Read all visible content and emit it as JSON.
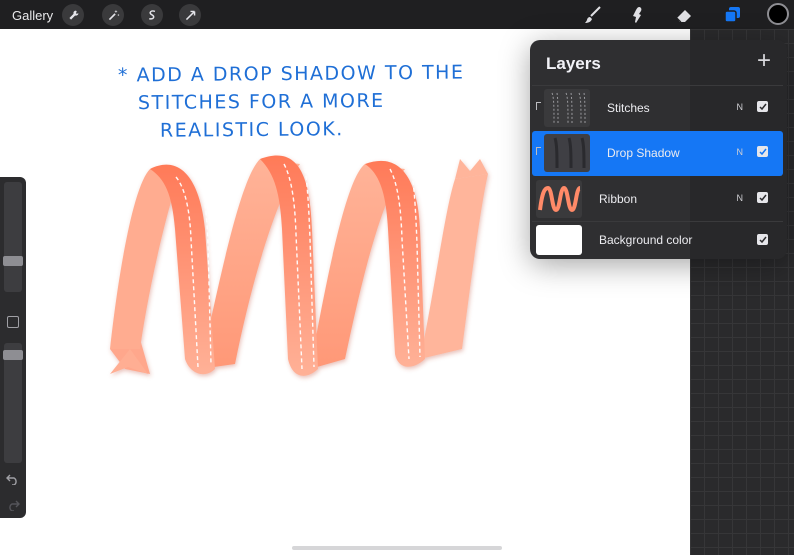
{
  "toolbar": {
    "gallery_label": "Gallery",
    "left_tools": [
      "wrench-icon",
      "magic-wand-icon",
      "selection-icon",
      "transform-icon"
    ],
    "right_tools": [
      "brush-icon",
      "smudge-icon",
      "eraser-icon",
      "layers-icon"
    ],
    "active_color": "#000000"
  },
  "canvas": {
    "note_lines": [
      "* ADD A DROP SHADOW TO THE",
      "STITCHES FOR A MORE",
      "REALISTIC LOOK."
    ],
    "note_color": "#1f6fd6",
    "ribbon_color": "#ff7f5f"
  },
  "layers_panel": {
    "title": "Layers",
    "layers": [
      {
        "name": "Stitches",
        "blend": "N",
        "visible": true,
        "clipped": true,
        "selected": false
      },
      {
        "name": "Drop Shadow",
        "blend": "N",
        "visible": true,
        "clipped": true,
        "selected": true
      },
      {
        "name": "Ribbon",
        "blend": "N",
        "visible": true,
        "clipped": false,
        "selected": false
      },
      {
        "name": "Background color",
        "blend": "",
        "visible": true,
        "clipped": false,
        "selected": false
      }
    ]
  },
  "accent_color": "#1577f5"
}
